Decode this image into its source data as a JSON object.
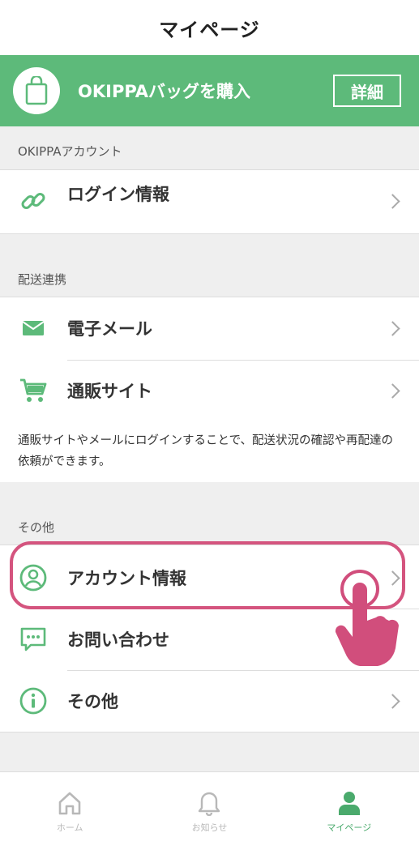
{
  "header": {
    "title": "マイページ"
  },
  "banner": {
    "text": "OKIPPAバッグを購入",
    "detail_label": "詳細",
    "bag_icon": "shopping-bag-icon"
  },
  "sections": {
    "account": {
      "label": "OKIPPAアカウント",
      "items": [
        {
          "label": "ログイン情報",
          "icon": "link-icon"
        }
      ]
    },
    "delivery": {
      "label": "配送連携",
      "items": [
        {
          "label": "電子メール",
          "icon": "mail-icon"
        },
        {
          "label": "通販サイト",
          "icon": "cart-icon"
        }
      ],
      "note": "通販サイトやメールにログインすることで、配送状況の確認や再配達の依頼ができます。"
    },
    "other": {
      "label": "その他",
      "items": [
        {
          "label": "アカウント情報",
          "icon": "account-icon"
        },
        {
          "label": "お問い合わせ",
          "icon": "chat-icon"
        },
        {
          "label": "その他",
          "icon": "info-icon"
        }
      ]
    }
  },
  "tabbar": {
    "items": [
      {
        "label": "ホーム",
        "icon": "home-icon",
        "active": false
      },
      {
        "label": "お知らせ",
        "icon": "bell-icon",
        "active": false
      },
      {
        "label": "マイページ",
        "icon": "person-icon",
        "active": true
      }
    ]
  },
  "colors": {
    "brand_green": "#5dba7a",
    "highlight_pink": "#d4547e",
    "tap_hand": "#d14e7c"
  }
}
